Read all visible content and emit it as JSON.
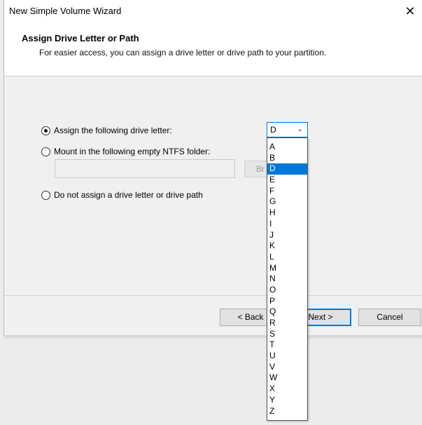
{
  "window": {
    "title": "New Simple Volume Wizard",
    "close_glyph": "✕"
  },
  "header": {
    "title": "Assign Drive Letter or Path",
    "subtitle": "For easier access, you can assign a drive letter or drive path to your partition."
  },
  "options": {
    "assign_letter": {
      "label": "Assign the following drive letter:",
      "selected": true
    },
    "mount_folder": {
      "label": "Mount in the following empty NTFS folder:",
      "selected": false
    },
    "no_assign": {
      "label": "Do not assign a drive letter or drive path",
      "selected": false
    }
  },
  "mount_folder": {
    "path_value": "",
    "browse_label_visible": "Br"
  },
  "drive_letter": {
    "selected_value": "D",
    "options": [
      "A",
      "B",
      "D",
      "E",
      "F",
      "G",
      "H",
      "I",
      "J",
      "K",
      "L",
      "M",
      "N",
      "O",
      "P",
      "Q",
      "R",
      "S",
      "T",
      "U",
      "V",
      "W",
      "X",
      "Y",
      "Z"
    ]
  },
  "buttons": {
    "back_label": "< Back",
    "next_label": "Next >",
    "cancel_label": "Cancel"
  },
  "icons": {
    "close": "close-icon",
    "dropdown_arrow": "chevron-down-icon"
  },
  "colors": {
    "accent": "#0078d7",
    "selection": "#0078d7"
  }
}
